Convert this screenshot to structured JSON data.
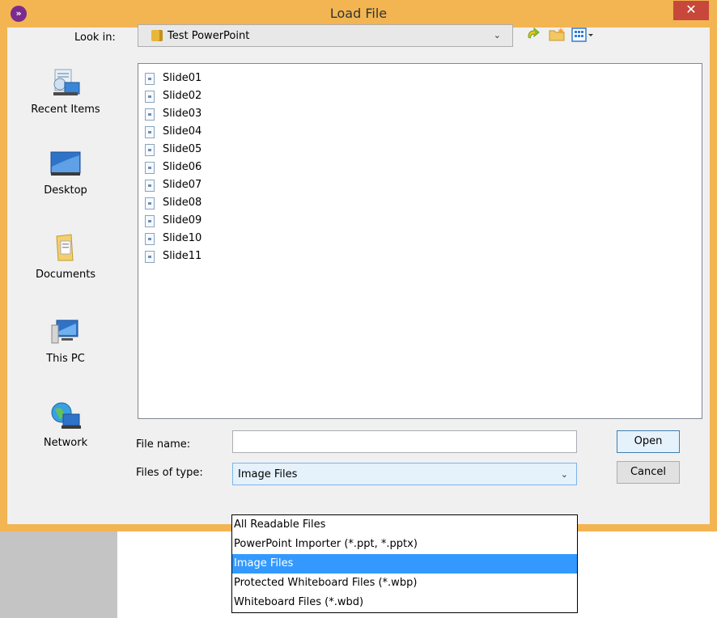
{
  "window": {
    "title": "Load File",
    "close_label": "✕",
    "app_icon_glyph": "»"
  },
  "look_in": {
    "label": "Look in:",
    "value": "Test PowerPoint",
    "caret": "⌄"
  },
  "toolbar": {
    "icons": [
      "up-one-level-icon",
      "create-new-folder-icon",
      "view-menu-icon"
    ]
  },
  "places": [
    {
      "label": "Recent Items",
      "icon": "recent-items-icon"
    },
    {
      "label": "Desktop",
      "icon": "desktop-icon"
    },
    {
      "label": "Documents",
      "icon": "documents-icon"
    },
    {
      "label": "This PC",
      "icon": "this-pc-icon"
    },
    {
      "label": "Network",
      "icon": "network-icon"
    }
  ],
  "files": [
    "Slide01",
    "Slide02",
    "Slide03",
    "Slide04",
    "Slide05",
    "Slide06",
    "Slide07",
    "Slide08",
    "Slide09",
    "Slide10",
    "Slide11"
  ],
  "file_name": {
    "label": "File name:",
    "value": ""
  },
  "files_of_type": {
    "label": "Files of type:",
    "value": "Image Files",
    "caret": "⌄",
    "options": [
      "All Readable Files",
      "PowerPoint Importer (*.ppt, *.pptx)",
      "Image Files",
      "Protected Whiteboard Files (*.wbp)",
      "Whiteboard Files (*.wbd)"
    ],
    "selected_index": 2
  },
  "buttons": {
    "open": "Open",
    "cancel": "Cancel"
  },
  "colors": {
    "frame": "#f2b552",
    "close": "#c7473a",
    "selection": "#3399ff"
  }
}
